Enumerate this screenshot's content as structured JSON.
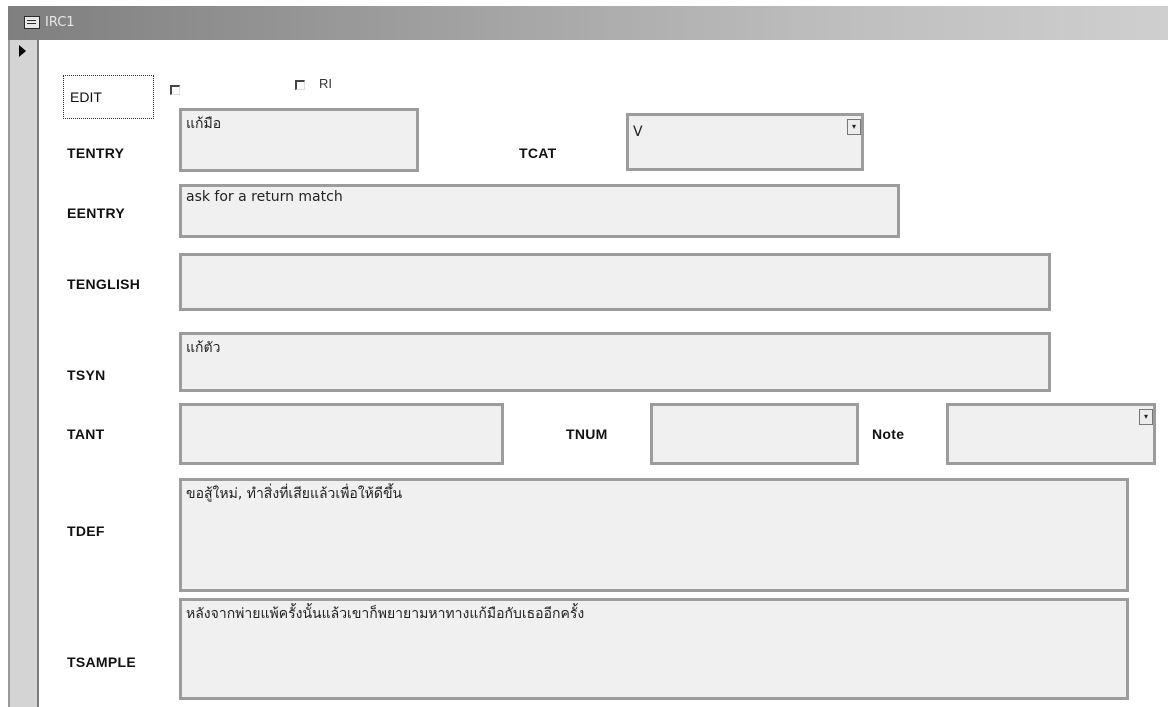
{
  "window": {
    "title": "IRC1"
  },
  "form": {
    "edit_label": "EDIT",
    "checkbox_ri_label": "RI",
    "tentry": {
      "label": "TENTRY",
      "value": "แก้มือ"
    },
    "tcat": {
      "label": "TCAT",
      "value": "V"
    },
    "eentry": {
      "label": "EENTRY",
      "value": "ask for a return match"
    },
    "tenglish": {
      "label": "TENGLISH",
      "value": ""
    },
    "tsyn": {
      "label": "TSYN",
      "value": "แก้ตัว"
    },
    "tant": {
      "label": "TANT",
      "value": ""
    },
    "tnum": {
      "label": "TNUM",
      "value": ""
    },
    "note": {
      "label": "Note",
      "value": ""
    },
    "tdef": {
      "label": "TDEF",
      "value": "ขอสู้ใหม่, ทำสิ่งที่เสียแล้วเพื่อให้ดีขึ้น"
    },
    "tsample": {
      "label": "TSAMPLE",
      "value": "หลังจากพ่ายแพ้ครั้งนั้นแล้วเขาก็พยายามหาทางแก้มือกับเธออีกครั้ง"
    }
  },
  "icons": {
    "window": "form-window-icon",
    "record": "current-record-arrow-icon",
    "dropdown": "dropdown-arrow-icon"
  }
}
